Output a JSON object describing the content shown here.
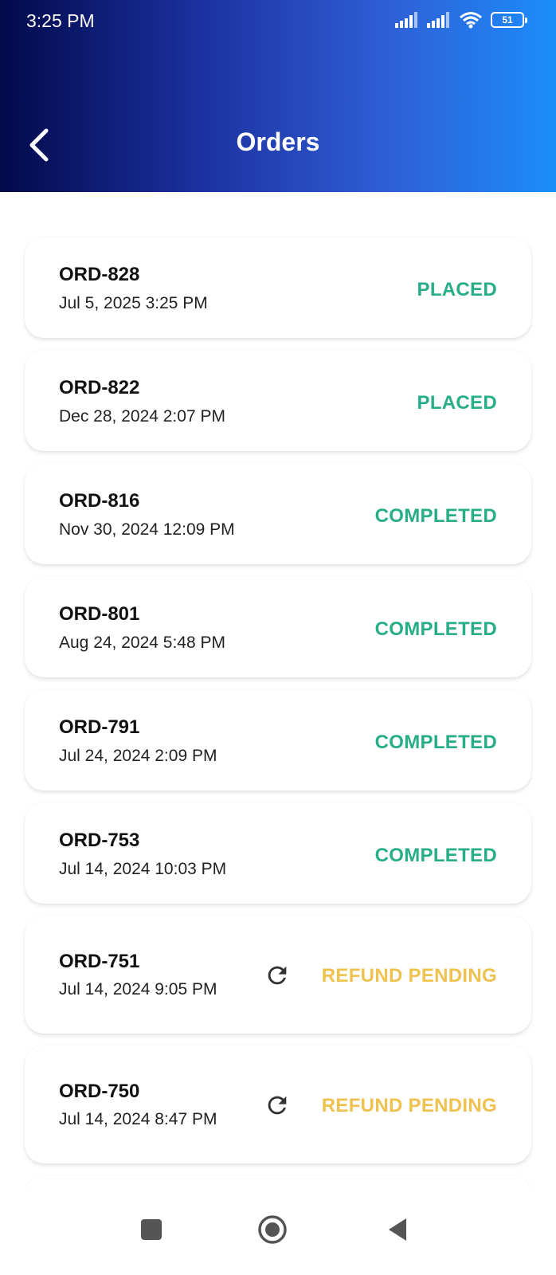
{
  "status_bar": {
    "time": "3:25 PM",
    "battery": "51",
    "icons": [
      "cellular-signal-icon",
      "cellular-signal-icon",
      "wifi-icon",
      "battery-icon"
    ]
  },
  "header": {
    "title": "Orders",
    "back_icon": "chevron-left-icon"
  },
  "colors": {
    "gradient_start": "#020a4a",
    "gradient_end": "#1b8dfb",
    "status_green": "#27ad87",
    "status_yellow": "#efc24f"
  },
  "orders": [
    {
      "id": "ORD-828",
      "date": "Jul 5, 2025 3:25 PM",
      "status": "PLACED"
    },
    {
      "id": "ORD-822",
      "date": "Dec 28, 2024 2:07 PM",
      "status": "PLACED"
    },
    {
      "id": "ORD-816",
      "date": "Nov 30, 2024 12:09 PM",
      "status": "COMPLETED"
    },
    {
      "id": "ORD-801",
      "date": "Aug 24, 2024 5:48 PM",
      "status": "COMPLETED"
    },
    {
      "id": "ORD-791",
      "date": "Jul 24, 2024 2:09 PM",
      "status": "COMPLETED"
    },
    {
      "id": "ORD-753",
      "date": "Jul 14, 2024 10:03 PM",
      "status": "COMPLETED"
    },
    {
      "id": "ORD-751",
      "date": "Jul 14, 2024 9:05 PM",
      "status": "REFUND PENDING",
      "icon": "refresh-icon"
    },
    {
      "id": "ORD-750",
      "date": "Jul 14, 2024 8:47 PM",
      "status": "REFUND PENDING",
      "icon": "refresh-icon"
    }
  ],
  "nav_bar": {
    "icons": [
      "recents-square-icon",
      "home-circle-icon",
      "back-triangle-icon"
    ]
  }
}
